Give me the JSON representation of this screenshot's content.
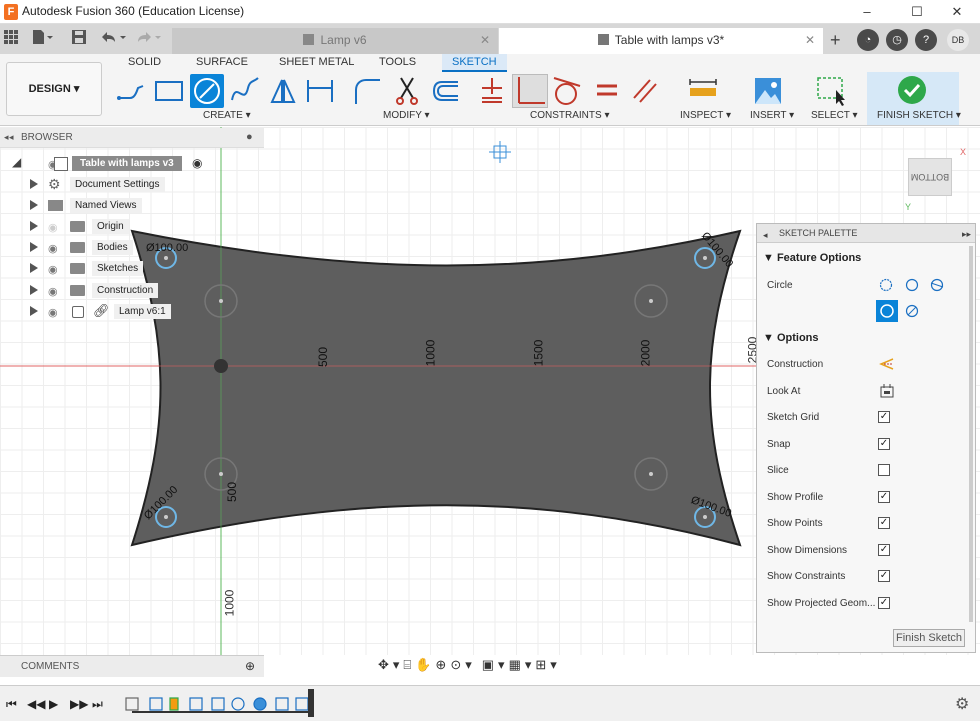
{
  "app": {
    "title": "Autodesk Fusion 360 (Education License)",
    "icon_letter": "F",
    "window_controls": [
      "–",
      "☐",
      "✕"
    ]
  },
  "tabs": {
    "inactive": {
      "label": "Lamp v6"
    },
    "active": {
      "label": "Table with lamps v3*"
    },
    "close": "✕"
  },
  "user": {
    "initials": "DB"
  },
  "ribbon": {
    "design_label": "DESIGN ▾",
    "tabs": [
      "SOLID",
      "SURFACE",
      "SHEET METAL",
      "TOOLS",
      "SKETCH"
    ],
    "selected_tab": "SKETCH",
    "groups": {
      "create": "CREATE ▾",
      "modify": "MODIFY ▾",
      "constraints": "CONSTRAINTS ▾",
      "inspect": "INSPECT ▾",
      "insert": "INSERT ▾",
      "select": "SELECT ▾",
      "finish": "FINISH SKETCH ▾"
    },
    "accent": "#0a70c4",
    "finish_color": "#2ea84a"
  },
  "browser": {
    "title": "BROWSER",
    "root": "Table with lamps v3",
    "items": [
      {
        "label": "Document Settings",
        "icon": "gear-icon"
      },
      {
        "label": "Named Views",
        "icon": "folder-icon"
      },
      {
        "label": "Origin",
        "icon": "folder-icon"
      },
      {
        "label": "Bodies",
        "icon": "folder-icon"
      },
      {
        "label": "Sketches",
        "icon": "folder-icon"
      },
      {
        "label": "Construction",
        "icon": "folder-icon"
      },
      {
        "label": "Lamp v6:1",
        "icon": "component-link-icon"
      }
    ]
  },
  "canvas": {
    "dimensions": {
      "d500": "500",
      "d1000": "1000",
      "d1500": "1500",
      "d2000": "2000",
      "d2500": "2500",
      "v500": "500",
      "v1000": "1000"
    },
    "diameter_label": "Ø100.00",
    "viewcube": "BOTTOM",
    "sketch_fill": "#555555"
  },
  "palette": {
    "title": "SKETCH PALETTE",
    "feature_options": "Feature Options",
    "circle_label": "Circle",
    "options_title": "Options",
    "options": [
      {
        "label": "Construction",
        "type": "icon"
      },
      {
        "label": "Look At",
        "type": "icon"
      },
      {
        "label": "Sketch Grid",
        "checked": true
      },
      {
        "label": "Snap",
        "checked": true
      },
      {
        "label": "Slice",
        "checked": false
      },
      {
        "label": "Show Profile",
        "checked": true
      },
      {
        "label": "Show Points",
        "checked": true
      },
      {
        "label": "Show Dimensions",
        "checked": true
      },
      {
        "label": "Show Constraints",
        "checked": true
      },
      {
        "label": "Show Projected Geom...",
        "checked": true
      }
    ],
    "finish_button": "Finish Sketch"
  },
  "comments": {
    "label": "COMMENTS"
  }
}
